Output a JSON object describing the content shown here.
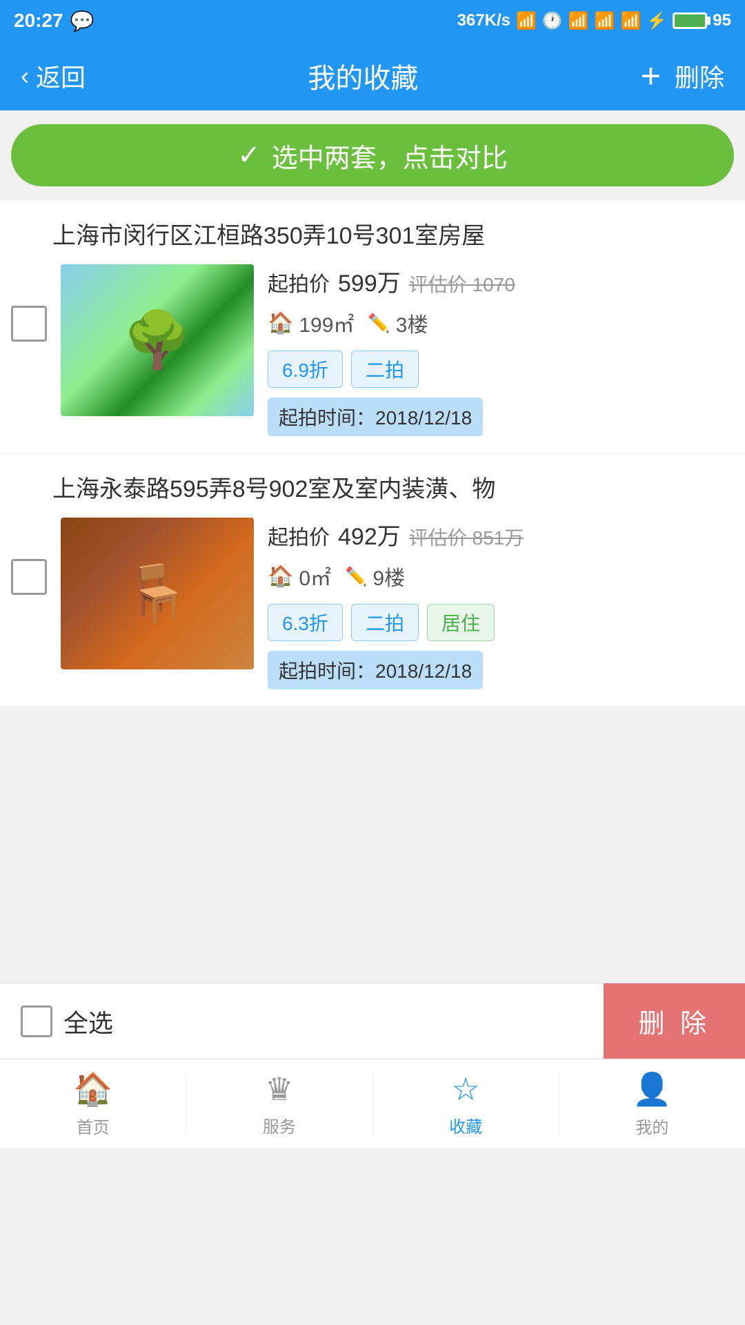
{
  "statusBar": {
    "time": "20:27",
    "network": "367K/s",
    "battery": "95"
  },
  "navBar": {
    "backLabel": "返回",
    "title": "我的收藏",
    "addLabel": "+",
    "deleteLabel": "删除"
  },
  "compareBanner": {
    "icon": "✓",
    "text": "选中两套，点击对比"
  },
  "properties": [
    {
      "id": "prop1",
      "title": "上海市闵行区江桓路350弄10号301室房屋",
      "priceLabel": "起拍价",
      "priceMain": "599万",
      "priceEstimated": "评估价 1070",
      "area": "199㎡",
      "floor": "3楼",
      "tags": [
        "6.9折",
        "二拍"
      ],
      "timeLabel": "起拍时间：2018/12/18",
      "imgType": "garden"
    },
    {
      "id": "prop2",
      "title": "上海永泰路595弄8号902室及室内装潢、物",
      "priceLabel": "起拍价",
      "priceMain": "492万",
      "priceEstimated": "评估价 851万",
      "area": "0㎡",
      "floor": "9楼",
      "tags": [
        "6.3折",
        "二拍",
        "居住"
      ],
      "timeLabel": "起拍时间：2018/12/18",
      "imgType": "room"
    }
  ],
  "bottomBar": {
    "selectAllLabel": "全选",
    "deleteLabel": "删 除"
  },
  "tabBar": {
    "tabs": [
      {
        "id": "home",
        "icon": "🏠",
        "label": "首页",
        "active": false
      },
      {
        "id": "service",
        "icon": "♛",
        "label": "服务",
        "active": false
      },
      {
        "id": "favorites",
        "icon": "☆",
        "label": "收藏",
        "active": true
      },
      {
        "id": "mine",
        "icon": "👤",
        "label": "我的",
        "active": false
      }
    ]
  }
}
